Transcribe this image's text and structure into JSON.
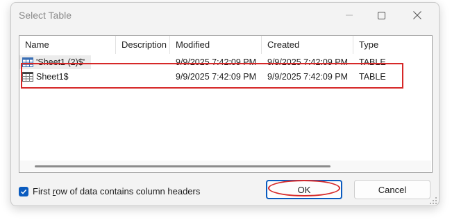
{
  "window": {
    "title": "Select Table"
  },
  "list": {
    "columns": [
      "Name",
      "Description",
      "Modified",
      "Created",
      "Type"
    ],
    "rows": [
      {
        "name": "'Sheet1 (2)$'",
        "description": "",
        "modified": "9/9/2025 7:42:09 PM",
        "created": "9/9/2025 7:42:09 PM",
        "type": "TABLE"
      },
      {
        "name": "Sheet1$",
        "description": "",
        "modified": "9/9/2025 7:42:09 PM",
        "created": "9/9/2025 7:42:09 PM",
        "type": "TABLE"
      }
    ]
  },
  "options": {
    "first_row_headers": {
      "label_prefix": "First ",
      "label_accel": "r",
      "label_rest": "ow of data contains column headers",
      "checked": true
    }
  },
  "buttons": {
    "ok_label": "OK",
    "cancel_label": "Cancel"
  },
  "colors": {
    "accent": "#0a5bbf",
    "annotation": "#d62828"
  },
  "icons": [
    "minimize-icon",
    "maximize-icon",
    "close-icon",
    "table-icon",
    "checkmark-icon",
    "resize-grip-icon"
  ]
}
